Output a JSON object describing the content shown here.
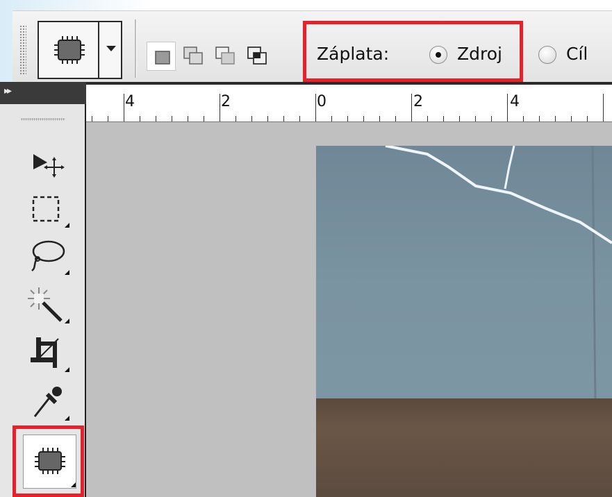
{
  "options_bar": {
    "patch_label": "Záplata:",
    "source_option": "Zdroj",
    "destination_option": "Cíl",
    "selected": "Zdroj",
    "highlight_color": "#e8202a"
  },
  "ruler": {
    "labels": [
      "4",
      "2",
      "0",
      "2",
      "4"
    ]
  },
  "tools": {
    "icons": [
      "move-tool",
      "marquee-tool",
      "lasso-tool",
      "magic-wand-tool",
      "crop-tool",
      "eyedropper-tool",
      "patch-tool"
    ],
    "active": "patch-tool"
  }
}
